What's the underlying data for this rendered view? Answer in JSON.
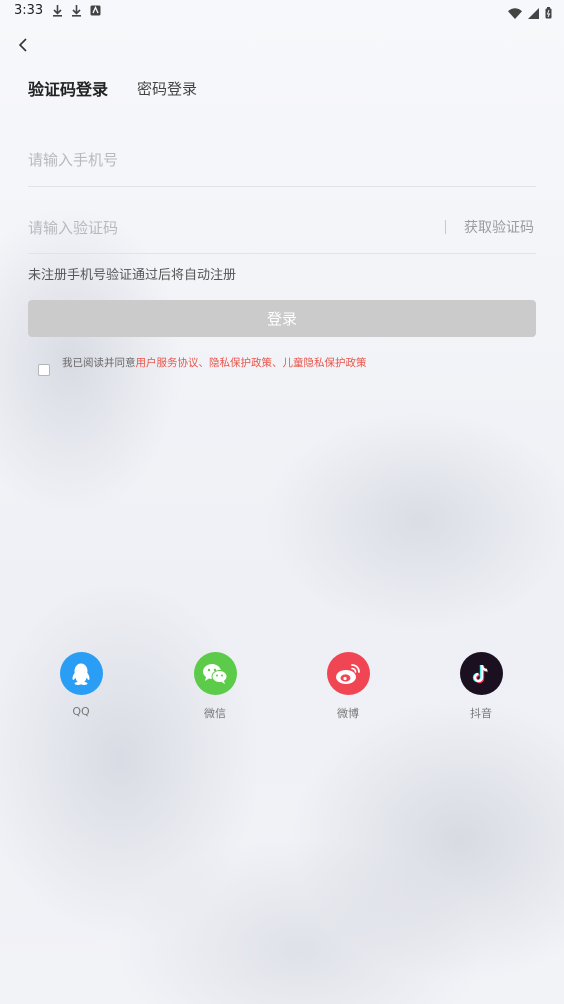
{
  "status_bar": {
    "time": "3:33"
  },
  "tabs": {
    "sms_login": "验证码登录",
    "password_login": "密码登录"
  },
  "form": {
    "phone_placeholder": "请输入手机号",
    "code_placeholder": "请输入验证码",
    "get_code": "获取验证码",
    "hint": "未注册手机号验证通过后将自动注册",
    "login_button": "登录"
  },
  "agreement": {
    "prefix": "我已阅读并同意",
    "user_agreement": "用户服务协议",
    "sep1": "、",
    "privacy_policy": "隐私保护政策",
    "sep2": "、",
    "child_privacy": "儿童隐私保护政策"
  },
  "social": [
    {
      "label": "QQ",
      "icon": "qq-icon",
      "color": "#2a9df4"
    },
    {
      "label": "微信",
      "icon": "wechat-icon",
      "color": "#5ccb4a"
    },
    {
      "label": "微博",
      "icon": "weibo-icon",
      "color": "#f04654"
    },
    {
      "label": "抖音",
      "icon": "douyin-icon",
      "color": "#1a1020"
    }
  ],
  "colors": {
    "accent_link": "#e9544a",
    "button_disabled": "#cbcbcb"
  }
}
